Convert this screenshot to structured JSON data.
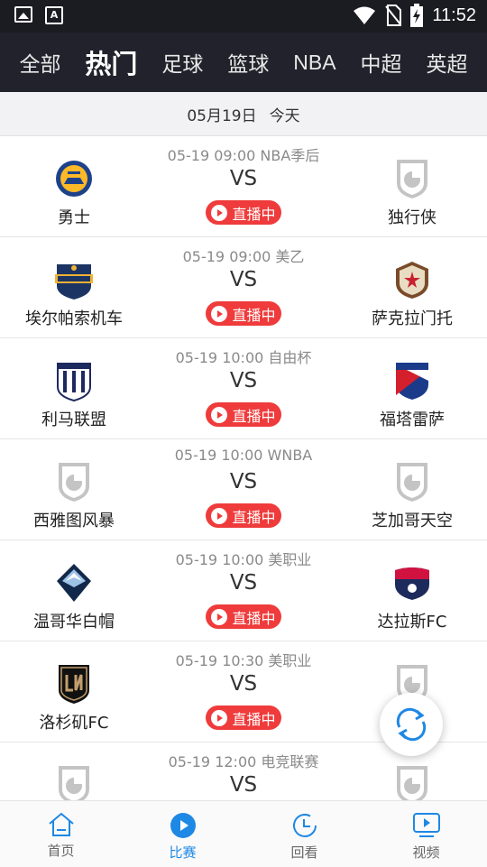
{
  "statusbar": {
    "time": "11:52",
    "icons": [
      "image-icon",
      "text-icon",
      "wifi-icon",
      "no-sim-icon",
      "battery-charging-icon"
    ]
  },
  "tabs": [
    {
      "label": "全部",
      "active": false
    },
    {
      "label": "热门",
      "active": true
    },
    {
      "label": "足球",
      "active": false
    },
    {
      "label": "篮球",
      "active": false
    },
    {
      "label": "NBA",
      "active": false
    },
    {
      "label": "中超",
      "active": false
    },
    {
      "label": "英超",
      "active": false
    }
  ],
  "date": {
    "date": "05月19日",
    "today": "今天"
  },
  "live_label": "直播中",
  "vs_label": "VS",
  "matches": [
    {
      "meta": "05-19 09:00 NBA季后",
      "home": "勇士",
      "away": "独行侠",
      "home_logo": "warriors-logo",
      "away_logo": "default-shield-icon",
      "live": true
    },
    {
      "meta": "05-19 09:00 美乙",
      "home": "埃尔帕索机车",
      "away": "萨克拉门托",
      "home_logo": "locomotive-logo",
      "away_logo": "republic-fc-logo",
      "live": true
    },
    {
      "meta": "05-19 10:00 自由杯",
      "home": "利马联盟",
      "away": "福塔雷萨",
      "home_logo": "alianza-lima-logo",
      "away_logo": "fortaleza-logo",
      "live": true
    },
    {
      "meta": "05-19 10:00 WNBA",
      "home": "西雅图风暴",
      "away": "芝加哥天空",
      "home_logo": "default-shield-icon",
      "away_logo": "default-shield-icon",
      "live": true
    },
    {
      "meta": "05-19 10:00 美职业",
      "home": "温哥华白帽",
      "away": "达拉斯FC",
      "home_logo": "whitecaps-logo",
      "away_logo": "fc-dallas-logo",
      "live": true
    },
    {
      "meta": "05-19 10:30 美职业",
      "home": "洛杉矶FC",
      "away": "",
      "home_logo": "lafc-logo",
      "away_logo": "default-shield-icon",
      "live": true
    },
    {
      "meta": "05-19 12:00 电竞联赛",
      "home": "",
      "away": "",
      "home_logo": "default-shield-icon",
      "away_logo": "default-shield-icon",
      "live": false
    }
  ],
  "fab": {
    "icon": "refresh-icon"
  },
  "nav": [
    {
      "label": "首页",
      "icon": "home-icon",
      "active": false
    },
    {
      "label": "比赛",
      "icon": "play-circle-icon",
      "active": true
    },
    {
      "label": "回看",
      "icon": "replay-clock-icon",
      "active": false
    },
    {
      "label": "视频",
      "icon": "video-icon",
      "active": false
    }
  ],
  "colors": {
    "header_bg": "#22222c",
    "live_red": "#ef3b3b",
    "accent_blue": "#1e88e5"
  }
}
